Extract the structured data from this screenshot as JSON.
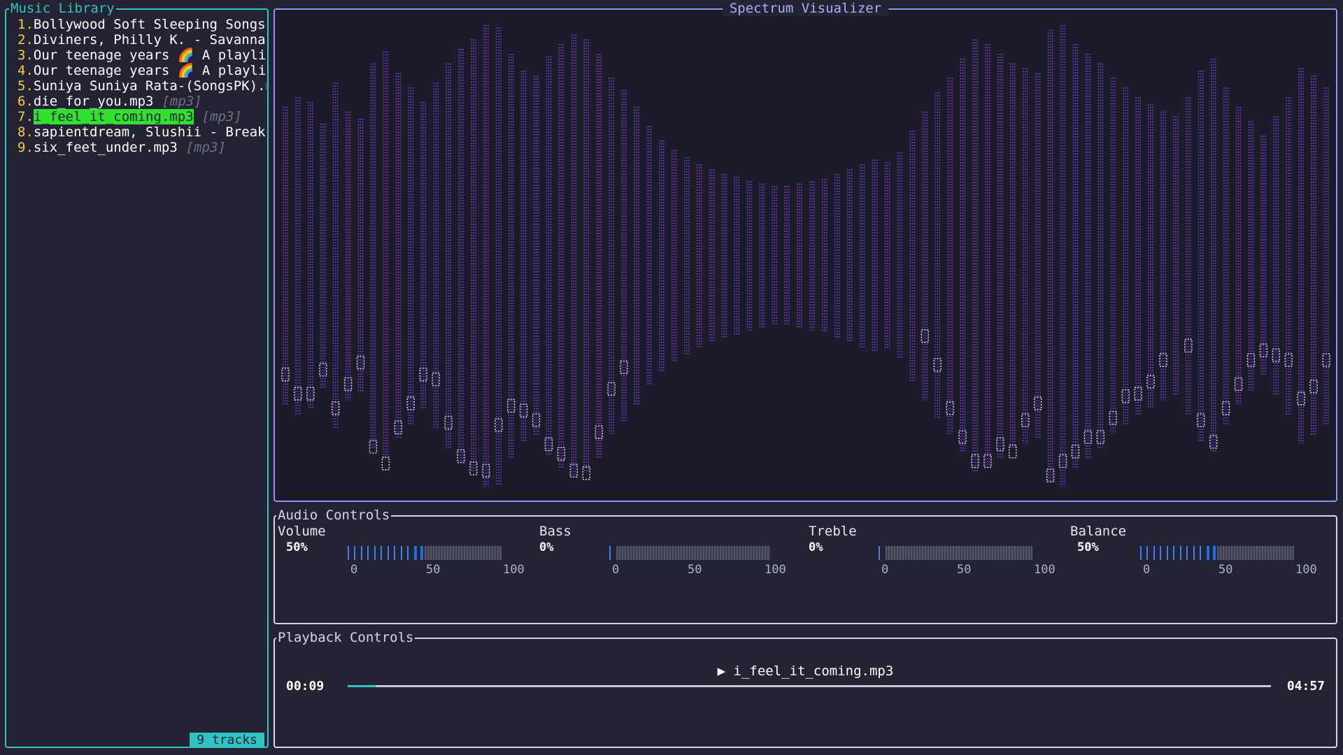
{
  "library": {
    "title": "Music Library",
    "count_label": "9 tracks",
    "tracks": [
      {
        "num": "1.",
        "name": "Bollywood Soft Sleeping Songs",
        "ext": ""
      },
      {
        "num": "2.",
        "name": "Diviners, Philly K. - Savannah",
        "ext": ""
      },
      {
        "num": "3.",
        "name": "Our teenage years 🌈 A playlis",
        "ext": ""
      },
      {
        "num": "4.",
        "name": "Our teenage years 🌈 A playlis",
        "ext": ""
      },
      {
        "num": "5.",
        "name": "Suniya Suniya Rata-(SongsPK).m",
        "ext": ""
      },
      {
        "num": "6.",
        "name": "die_for_you.mp3",
        "ext": "[mp3]"
      },
      {
        "num": "7.",
        "name": "i_feel_it_coming.mp3",
        "ext": "[mp3]",
        "selected": true
      },
      {
        "num": "8.",
        "name": "sapientdream, Slushii - Break",
        "ext": ""
      },
      {
        "num": "9.",
        "name": "six_feet_under.mp3",
        "ext": "[mp3]"
      }
    ]
  },
  "visualizer": {
    "title": "Spectrum Visualizer",
    "bar_color": "#7a3fd6",
    "peak_color": "#e6e6f0",
    "levels": [
      0.62,
      0.66,
      0.64,
      0.55,
      0.72,
      0.6,
      0.57,
      0.8,
      0.85,
      0.76,
      0.7,
      0.64,
      0.72,
      0.8,
      0.86,
      0.9,
      0.96,
      0.95,
      0.84,
      0.77,
      0.75,
      0.83,
      0.88,
      0.92,
      0.9,
      0.84,
      0.74,
      0.69,
      0.62,
      0.54,
      0.48,
      0.44,
      0.41,
      0.38,
      0.36,
      0.34,
      0.33,
      0.31,
      0.3,
      0.29,
      0.29,
      0.3,
      0.31,
      0.32,
      0.34,
      0.36,
      0.38,
      0.4,
      0.39,
      0.43,
      0.52,
      0.6,
      0.68,
      0.74,
      0.82,
      0.9,
      0.88,
      0.84,
      0.8,
      0.78,
      0.76,
      0.94,
      0.96,
      0.88,
      0.84,
      0.8,
      0.74,
      0.7,
      0.66,
      0.63,
      0.6,
      0.58,
      0.66,
      0.77,
      0.82,
      0.7,
      0.62,
      0.56,
      0.5,
      0.58,
      0.66,
      0.78,
      0.75,
      0.7
    ],
    "peaks": [
      0.24,
      0.2,
      0.18,
      0.19,
      0.2,
      0.18,
      0.24,
      0.12,
      0.1,
      0.16,
      0.2,
      0.26,
      0.32,
      0.22,
      0.14,
      0.13,
      0.18,
      0.36,
      0.33,
      0.24,
      0.18,
      0.16,
      0.17,
      0.14,
      0.11,
      0.22,
      0.3,
      0.34,
      0.0,
      0.0,
      0.0,
      0.0,
      0.0,
      0.0,
      0.0,
      0.0,
      0.0,
      0.0,
      0.0,
      0.0,
      0.0,
      0.0,
      0.0,
      0.0,
      0.0,
      0.0,
      0.0,
      0.0,
      0.0,
      0.0,
      0.0,
      0.38,
      0.34,
      0.22,
      0.18,
      0.16,
      0.14,
      0.17,
      0.1,
      0.21,
      0.26,
      0.14,
      0.22,
      0.18,
      0.2,
      0.16,
      0.18,
      0.23,
      0.2,
      0.22,
      0.28,
      0.0,
      0.4,
      0.2,
      0.16,
      0.18,
      0.2,
      0.24,
      0.22,
      0.28,
      0.34,
      0.3,
      0.32,
      0.38
    ]
  },
  "audio": {
    "title": "Audio Controls",
    "controls": [
      {
        "label": "Volume",
        "value": "50%",
        "level": 0.5,
        "scale": [
          "0",
          "50",
          "100"
        ]
      },
      {
        "label": "Bass",
        "value": "0%",
        "level": 0.0,
        "scale": [
          "0",
          "50",
          "100"
        ]
      },
      {
        "label": "Treble",
        "value": "0%",
        "level": 0.0,
        "scale": [
          "0",
          "50",
          "100"
        ]
      },
      {
        "label": "Balance",
        "value": "50%",
        "level": 0.5,
        "scale": [
          "0",
          "50",
          "100"
        ]
      }
    ],
    "active_color": "#1f6fe8",
    "tick_color": "#3b82f6"
  },
  "playback": {
    "title": "Playback Controls",
    "now_playing": "▶ i_feel_it_coming.mp3",
    "elapsed": "00:09",
    "duration": "04:57",
    "progress": 0.03
  }
}
